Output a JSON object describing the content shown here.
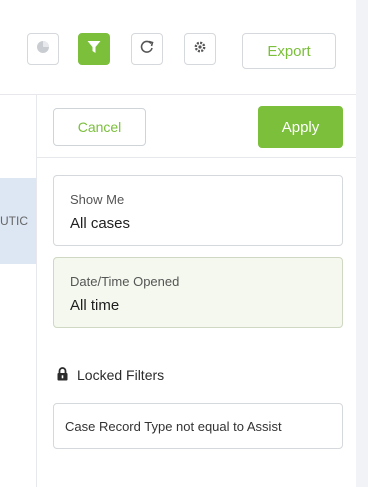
{
  "toolbar": {
    "export_label": "Export",
    "icons": [
      "pie-chart-icon",
      "filter-icon",
      "refresh-icon",
      "settings-icon"
    ],
    "accent_color": "#7bbf3b"
  },
  "background": {
    "truncated_column_text": "UTIC"
  },
  "filter_panel": {
    "cancel_label": "Cancel",
    "apply_label": "Apply",
    "filters": [
      {
        "label": "Show Me",
        "value": "All cases"
      },
      {
        "label": "Date/Time Opened",
        "value": "All time"
      }
    ],
    "locked_filters_heading": "Locked Filters",
    "locked_filters": [
      "Case Record Type not equal to Assist"
    ]
  }
}
